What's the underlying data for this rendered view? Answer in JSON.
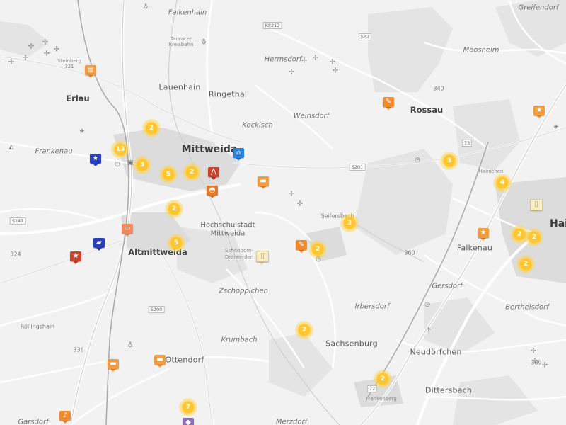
{
  "map": {
    "labels": {
      "falkenhain": "Falkenhain",
      "greifendorf": "Greifendorf",
      "k8212": "K8212",
      "s32": "S32",
      "hermsdorf": "Hermsdorf",
      "moosheim": "Moosheim",
      "taura1": "Tauracer",
      "taura2": "Kreisbahn",
      "steinberg": "Steinberg",
      "n321": "321",
      "lauenhain": "Lauenhain",
      "ringethal": "Ringethal",
      "erlau": "Erlau",
      "rossau": "Rossau",
      "weinsdorf": "Weinsdorf",
      "kockisch": "Kockisch",
      "frankenau": "Frankenau",
      "mittweida": "Mittweida",
      "s201": "S201",
      "hainichen_small": "Hainichen",
      "s247": "S247",
      "n324": "324",
      "seifersbach": "Seifersbach",
      "hs1": "Hochschulstadt",
      "hs2": "Mittweida",
      "altmittweida": "Altmittweida",
      "schoenborn1": "Schönborn-",
      "schoenborn2": "Dreiwerden",
      "n360": "360",
      "falkenau": "Falkenau",
      "hai": "Hai",
      "gersdorf": "Gersdorf",
      "zschoppichen": "Zschoppichen",
      "s200": "S200",
      "irbersdorf": "Irbersdorf",
      "berthelsdorf": "Berthelsdorf",
      "roellingshain": "Röllingshain",
      "krumbach": "Krumbach",
      "sachsenburg": "Sachsenburg",
      "n336": "336",
      "neudoerfchen": "Neudörfchen",
      "ottendorf": "Ottendorf",
      "n389": "389",
      "frankenberg_small": "Frankenberg",
      "dittersbach": "Dittersbach",
      "n72": "72",
      "gersdorf_bottom": "Garsdorf",
      "merzdorf": "Merzdorf",
      "n340": "340",
      "n73": "73"
    },
    "clusters": [
      "2",
      "13",
      "3",
      "5",
      "2",
      "2",
      "5",
      "3",
      "2",
      "3",
      "4",
      "2",
      "2",
      "2",
      "2",
      "2",
      "7"
    ],
    "markers": {
      "m_erlau": "restaurant",
      "m_rossau": "tools",
      "m_right_top": "star",
      "m_star_blue": "star",
      "m_mittweida_blue": "home",
      "m_mittweida_red": "compass",
      "m_orange_a": "ferry",
      "m_orange_b": "ferry",
      "m_parking": "bus",
      "m_car": "car",
      "m_red_star": "star",
      "m_tools_mid": "tools",
      "m_paper": "document",
      "m_near_falkenau": "star",
      "m_paper_right": "document",
      "m_ottendorf": "ferry",
      "m_bottom_left": "ferry",
      "m_tools_bottom": "tools",
      "m_bottom_purple": "poi"
    }
  }
}
